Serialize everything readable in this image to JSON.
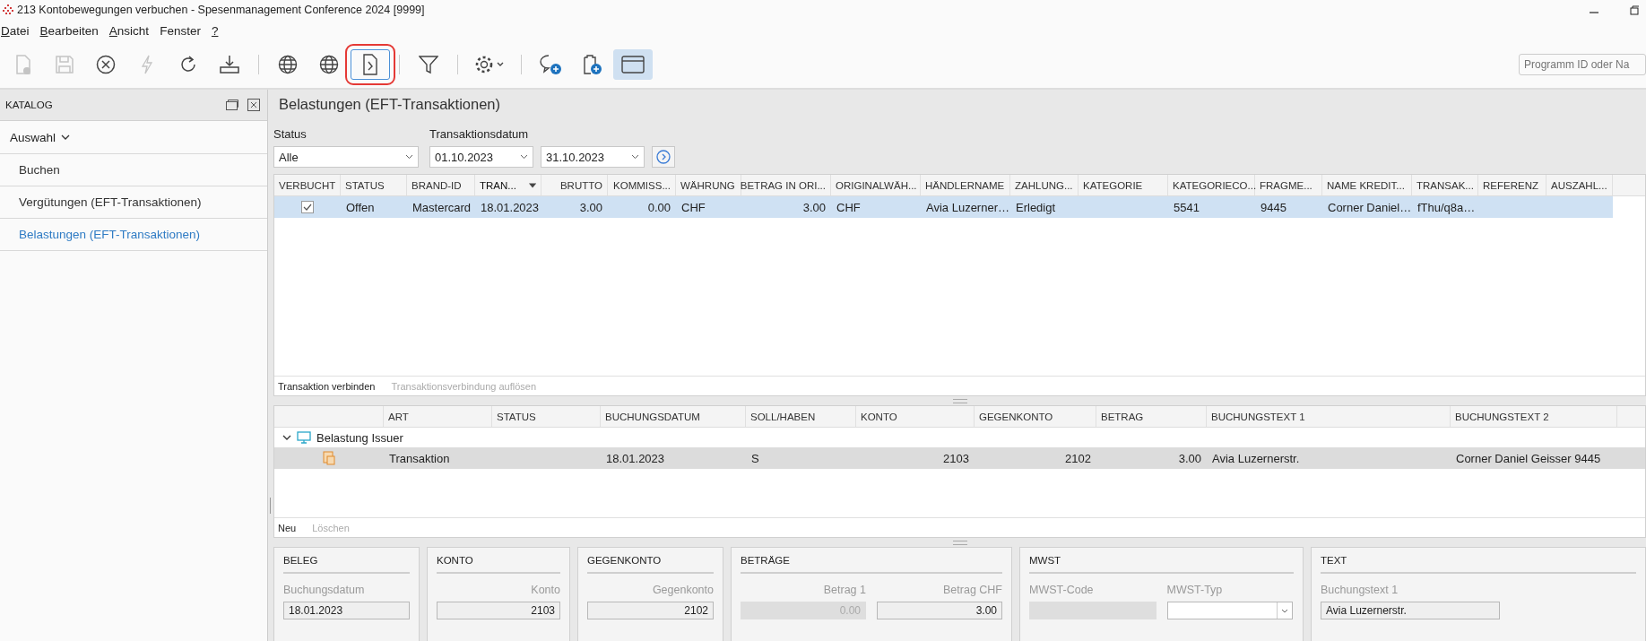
{
  "window": {
    "title": "213 Kontobewegungen verbuchen - Spesenmanagement Conference 2024 [9999]"
  },
  "menu": [
    {
      "label": "Datei",
      "mnemonic": true
    },
    {
      "label": "Bearbeiten",
      "mnemonic": true
    },
    {
      "label": "Ansicht",
      "mnemonic": true
    },
    {
      "label": "Fenster",
      "mnemonic": false
    },
    {
      "label": "?",
      "mnemonic": true
    }
  ],
  "toolbar": [
    {
      "kind": "new",
      "disabled": true,
      "pressed": false,
      "highlighted": false
    },
    {
      "kind": "save",
      "disabled": true,
      "pressed": false,
      "highlighted": false
    },
    {
      "kind": "cancel",
      "disabled": false,
      "pressed": false,
      "highlighted": false
    },
    {
      "kind": "flash",
      "disabled": true,
      "pressed": false,
      "highlighted": false
    },
    {
      "kind": "refresh",
      "disabled": false,
      "pressed": false,
      "highlighted": false
    },
    {
      "kind": "download",
      "disabled": false,
      "pressed": false,
      "highlighted": false
    },
    {
      "kind": "separator"
    },
    {
      "kind": "globe",
      "disabled": false,
      "pressed": false,
      "highlighted": false
    },
    {
      "kind": "globe",
      "disabled": false,
      "pressed": false,
      "highlighted": false
    },
    {
      "kind": "document",
      "disabled": false,
      "pressed": false,
      "highlighted": true
    },
    {
      "kind": "separator"
    },
    {
      "kind": "filter",
      "disabled": false,
      "pressed": false,
      "highlighted": false
    },
    {
      "kind": "separator"
    },
    {
      "kind": "gear",
      "disabled": false,
      "pressed": false,
      "highlighted": false
    },
    {
      "kind": "separator"
    },
    {
      "kind": "chat",
      "disabled": false,
      "pressed": false,
      "highlighted": false
    },
    {
      "kind": "clipboard",
      "disabled": false,
      "pressed": false,
      "highlighted": false
    },
    {
      "kind": "window",
      "disabled": false,
      "pressed": true,
      "highlighted": false
    }
  ],
  "search": {
    "placeholder": "Programm ID oder Na"
  },
  "sidebar": {
    "title": "KATALOG",
    "group": {
      "label": "Auswahl",
      "expanded": true
    },
    "items": [
      {
        "label": "Buchen",
        "selected": false
      },
      {
        "label": "Vergütungen (EFT-Transaktionen)",
        "selected": false
      },
      {
        "label": "Belastungen (EFT-Transaktionen)",
        "selected": true
      }
    ]
  },
  "content": {
    "title": "Belastungen (EFT-Transaktionen)"
  },
  "filters": {
    "status": {
      "label": "Status",
      "value": "Alle"
    },
    "date": {
      "label": "Transaktionsdatum",
      "from": "01.10.2023",
      "to": "31.10.2023"
    }
  },
  "transactions": {
    "columns": [
      {
        "label": "VERBUCHT",
        "sorted": false
      },
      {
        "label": "STATUS",
        "sorted": false
      },
      {
        "label": "BRAND-ID",
        "sorted": false
      },
      {
        "label": "TRAN...",
        "sorted": true
      },
      {
        "label": "BRUTTO",
        "sorted": false
      },
      {
        "label": "KOMMISS...",
        "sorted": false
      },
      {
        "label": "WÄHRUNG",
        "sorted": false
      },
      {
        "label": "BETRAG IN ORI...",
        "sorted": false
      },
      {
        "label": "ORIGINALWÄH...",
        "sorted": false
      },
      {
        "label": "HÄNDLERNAME",
        "sorted": false
      },
      {
        "label": "ZAHLUNG...",
        "sorted": false
      },
      {
        "label": "KATEGORIE",
        "sorted": false
      },
      {
        "label": "KATEGORIECO...",
        "sorted": false
      },
      {
        "label": "FRAGME...",
        "sorted": false
      },
      {
        "label": "NAME KREDIT...",
        "sorted": false
      },
      {
        "label": "TRANSAK...",
        "sorted": false
      },
      {
        "label": "REFERENZ",
        "sorted": false
      },
      {
        "label": "AUSZAHL...",
        "sorted": false
      }
    ],
    "rows": [
      {
        "selected": true,
        "cells": [
          {
            "checked": true
          },
          "Offen",
          "Mastercard",
          "18.01.2023",
          "3.00",
          "0.00",
          "CHF",
          "3.00",
          "CHF",
          "Avia Luzerner…",
          "Erledigt",
          "",
          "5541",
          "9445",
          "Corner Daniel…",
          "fThu/q8a…",
          "",
          ""
        ]
      }
    ],
    "actions": [
      {
        "label": "Transaktion verbinden",
        "disabled": false
      },
      {
        "label": "Transaktionsverbindung auflösen",
        "disabled": true
      }
    ]
  },
  "postings": {
    "columns": [
      {
        "label": "ART"
      },
      {
        "label": "STATUS"
      },
      {
        "label": "BUCHUNGSDATUM"
      },
      {
        "label": "SOLL/HABEN"
      },
      {
        "label": "KONTO"
      },
      {
        "label": "GEGENKONTO"
      },
      {
        "label": "BETRAG"
      },
      {
        "label": "BUCHUNGSTEXT 1"
      },
      {
        "label": "BUCHUNGSTEXT 2"
      }
    ],
    "group": {
      "label": "Belastung Issuer",
      "expanded": true,
      "rows": [
        {
          "selected": true,
          "cells": [
            "Transaktion",
            "",
            "18.01.2023",
            "S",
            "2103",
            "2102",
            "3.00",
            "Avia Luzernerstr.",
            "Corner Daniel Geisser 9445"
          ]
        }
      ]
    },
    "actions": [
      {
        "label": "Neu",
        "disabled": false
      },
      {
        "label": "Löschen",
        "disabled": true
      }
    ]
  },
  "panels": [
    {
      "title": "BELEG",
      "fields": [
        {
          "label": "Buchungsdatum",
          "value": "18.01.2023",
          "kind": "input",
          "disabled": false
        }
      ]
    },
    {
      "title": "KONTO",
      "fields": [
        {
          "label": "Konto",
          "value": "2103",
          "kind": "input",
          "disabled": false
        }
      ]
    },
    {
      "title": "GEGENKONTO",
      "fields": [
        {
          "label": "Gegenkonto",
          "value": "2102",
          "kind": "input",
          "disabled": false
        }
      ]
    },
    {
      "title": "BETRÄGE",
      "fields": [
        {
          "label": "Betrag 1",
          "value": "0.00",
          "kind": "input",
          "disabled": true
        },
        {
          "label": "Betrag CHF",
          "value": "3.00",
          "kind": "input",
          "disabled": false
        }
      ]
    },
    {
      "title": "MWST",
      "fields": [
        {
          "label": "MWST-Code",
          "kind": "input",
          "disabled": true
        },
        {
          "label": "MWST-Typ",
          "kind": "select",
          "disabled": false
        }
      ]
    },
    {
      "title": "TEXT",
      "fields": [
        {
          "label": "Buchungstext 1",
          "value": "Avia Luzernerstr.",
          "kind": "input",
          "disabled": false
        }
      ]
    }
  ]
}
